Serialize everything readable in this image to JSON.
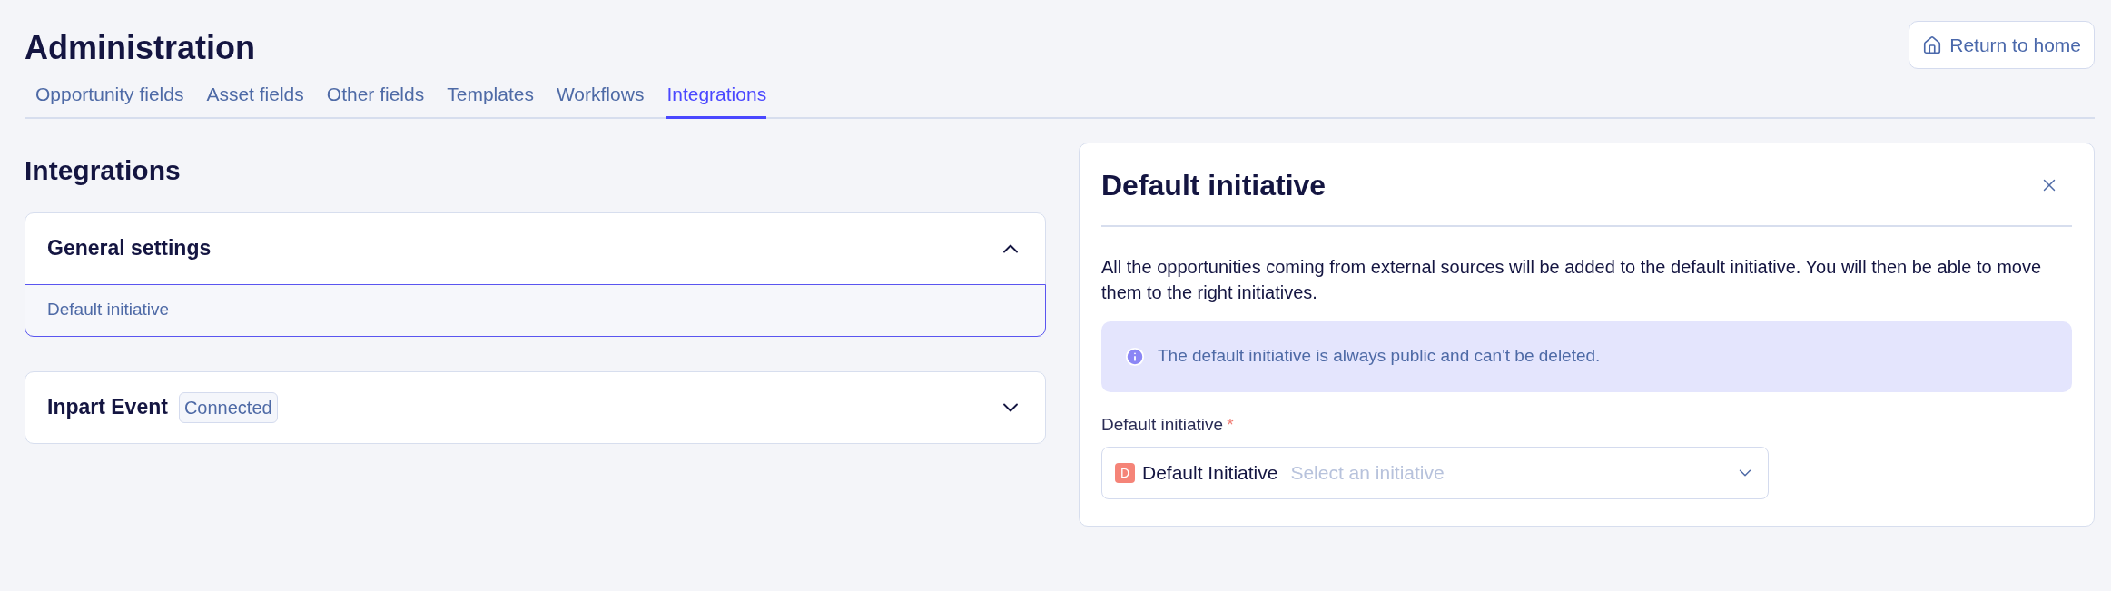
{
  "page": {
    "title": "Administration",
    "return_button": "Return to home"
  },
  "tabs": [
    {
      "label": "Opportunity fields",
      "selected": false
    },
    {
      "label": "Asset fields",
      "selected": false
    },
    {
      "label": "Other fields",
      "selected": false
    },
    {
      "label": "Templates",
      "selected": false
    },
    {
      "label": "Workflows",
      "selected": false
    },
    {
      "label": "Integrations",
      "selected": true
    }
  ],
  "integrations": {
    "heading": "Integrations",
    "sections": [
      {
        "title": "General settings",
        "expanded": true,
        "items": [
          {
            "label": "Default initiative",
            "selected": true
          }
        ]
      },
      {
        "title": "Inpart Event",
        "badge": "Connected",
        "expanded": false
      }
    ]
  },
  "panel": {
    "title": "Default initiative",
    "description": "All the opportunities coming from external sources will be added to the default initiative. You will then be able to move them to the right initiatives.",
    "info": "The default initiative is always public and can't be deleted.",
    "field": {
      "label": "Default initiative",
      "required_mark": "*",
      "value_initial": "D",
      "value": "Default Initiative",
      "placeholder": "Select an initiative"
    }
  }
}
